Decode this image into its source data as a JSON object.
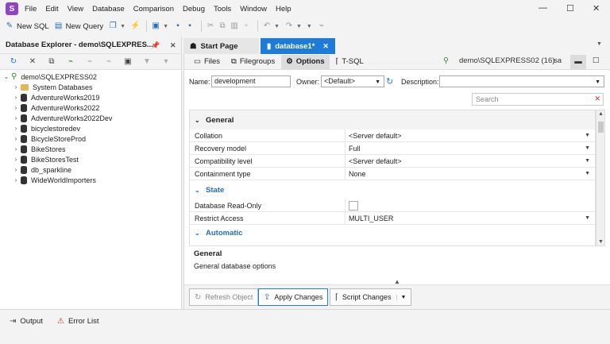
{
  "menu": [
    "File",
    "Edit",
    "View",
    "Database",
    "Comparison",
    "Debug",
    "Tools",
    "Window",
    "Help"
  ],
  "window_controls": {
    "minimize": "—",
    "maximize": "☐",
    "close": "✕"
  },
  "toolbar": {
    "new_sql": "New SQL",
    "new_query": "New Query"
  },
  "explorer": {
    "title": "Database Explorer - demo\\SQLEXPRES...",
    "server": "demo\\SQLEXPRESS02",
    "items": [
      "System Databases",
      "AdventureWorks2019",
      "AdventureWorks2022",
      "AdventureWorks2022Dev",
      "bicyclestoredev",
      "BicycleStoreProd",
      "BikeStores",
      "BikeStoresTest",
      "db_sparkline",
      "WideWorldImporters"
    ]
  },
  "tabs": {
    "start_page": "Start Page",
    "active": "database1*"
  },
  "subtabs": [
    "Files",
    "Filegroups",
    "Options",
    "T-SQL"
  ],
  "connection": {
    "server": "demo\\SQLEXPRESS02 (16)",
    "user": "sa"
  },
  "fields": {
    "name_label": "Name:",
    "name_value": "development",
    "owner_label": "Owner:",
    "owner_value": "<Default>",
    "description_label": "Description:",
    "description_value": "",
    "search_placeholder": "Search"
  },
  "sections": {
    "general": "General",
    "state": "State",
    "automatic": "Automatic"
  },
  "general_props": [
    {
      "name": "Collation",
      "value": "<Server default>",
      "dropdown": true
    },
    {
      "name": "Recovery model",
      "value": "Full",
      "dropdown": true
    },
    {
      "name": "Compatibility level",
      "value": "<Server default>",
      "dropdown": true
    },
    {
      "name": "Containment type",
      "value": "None",
      "dropdown": true
    }
  ],
  "state_props": [
    {
      "name": "Database Read-Only",
      "value": "",
      "checkbox": true
    },
    {
      "name": "Restrict Access",
      "value": "MULTI_USER",
      "dropdown": true
    }
  ],
  "description": {
    "title": "General",
    "text": "General database options"
  },
  "buttons": {
    "refresh": "Refresh Object",
    "apply": "Apply Changes",
    "script": "Script Changes"
  },
  "status": {
    "output": "Output",
    "errors": "Error List"
  },
  "colors": {
    "accent": "#1e7bd7",
    "section": "#1e6ebd",
    "server_icon": "#2e8b2e"
  }
}
